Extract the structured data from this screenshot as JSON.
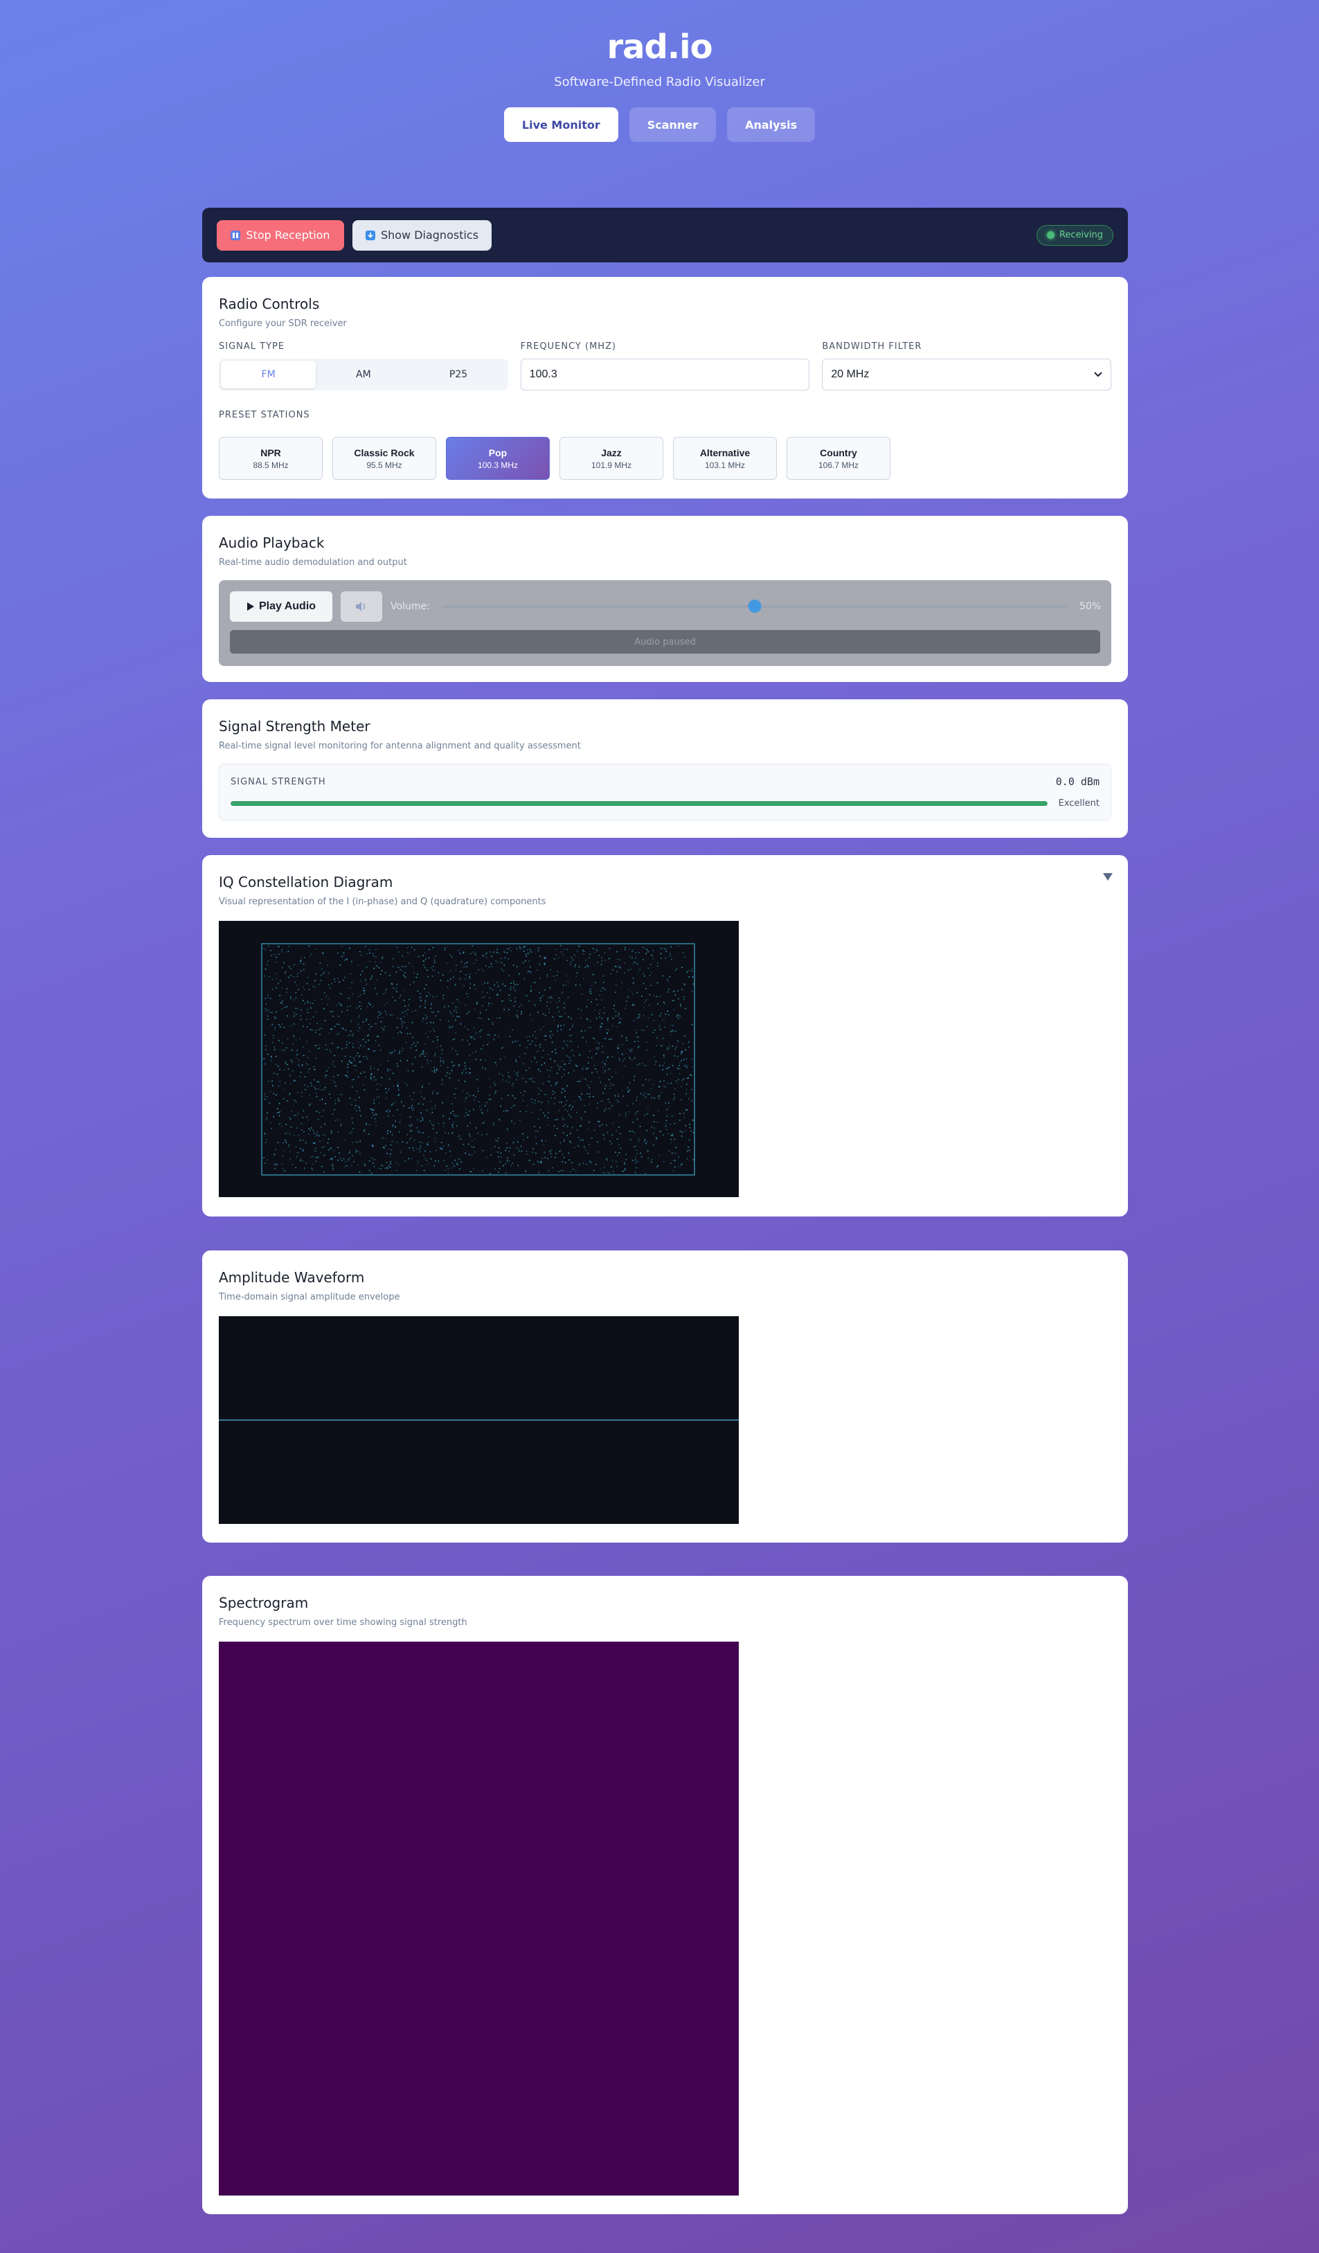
{
  "app": {
    "title": "rad.io",
    "subtitle": "Software-Defined Radio Visualizer"
  },
  "nav": {
    "tabs": [
      {
        "label": "Live Monitor",
        "active": true
      },
      {
        "label": "Scanner",
        "active": false
      },
      {
        "label": "Analysis",
        "active": false
      }
    ]
  },
  "toolbar": {
    "stop_label": "Stop Reception",
    "diagnostics_label": "Show Diagnostics",
    "status": "Receiving",
    "status_color": "#48bb78",
    "stop_icon": "stop-icon",
    "diagnostics_icon": "download-icon"
  },
  "radio_controls": {
    "title": "Radio Controls",
    "description": "Configure your SDR receiver",
    "signal_type_label": "Signal Type",
    "signal_types": [
      "FM",
      "AM",
      "P25"
    ],
    "selected_signal_type": "FM",
    "frequency_label": "Frequency (MHz)",
    "frequency_value": "100.3",
    "bandwidth_label": "Bandwidth Filter",
    "bandwidth_value": "20 MHz",
    "presets_label": "Preset Stations",
    "presets": [
      {
        "name": "NPR",
        "freq": "88.5 MHz",
        "active": false
      },
      {
        "name": "Classic Rock",
        "freq": "95.5 MHz",
        "active": false
      },
      {
        "name": "Pop",
        "freq": "100.3 MHz",
        "active": true
      },
      {
        "name": "Jazz",
        "freq": "101.9 MHz",
        "active": false
      },
      {
        "name": "Alternative",
        "freq": "103.1 MHz",
        "active": false
      },
      {
        "name": "Country",
        "freq": "106.7 MHz",
        "active": false
      }
    ]
  },
  "audio": {
    "title": "Audio Playback",
    "description": "Real-time audio demodulation and output",
    "play_label": "Play Audio",
    "volume_label": "Volume:",
    "volume_value": "50%",
    "volume_level": 0.5,
    "status": "Audio paused"
  },
  "signal_meter": {
    "title": "Signal Strength Meter",
    "description": "Real-time signal level monitoring for antenna alignment and quality assessment",
    "label": "Signal Strength",
    "value": "0.0",
    "unit": "dBm",
    "level": 1.0,
    "quality": "Excellent",
    "bar_color": "#38a169"
  },
  "iq": {
    "title": "IQ Constellation Diagram",
    "description": "Visual representation of the I (in-phase) and Q (quadrature) components",
    "point_color": "#3fa9c9"
  },
  "waveform": {
    "title": "Amplitude Waveform",
    "description": "Time-domain signal amplitude envelope",
    "line_color": "#4fb3d9"
  },
  "spectrogram": {
    "title": "Spectrogram",
    "description": "Frequency spectrum over time showing signal strength",
    "fill_color": "#42024f"
  }
}
